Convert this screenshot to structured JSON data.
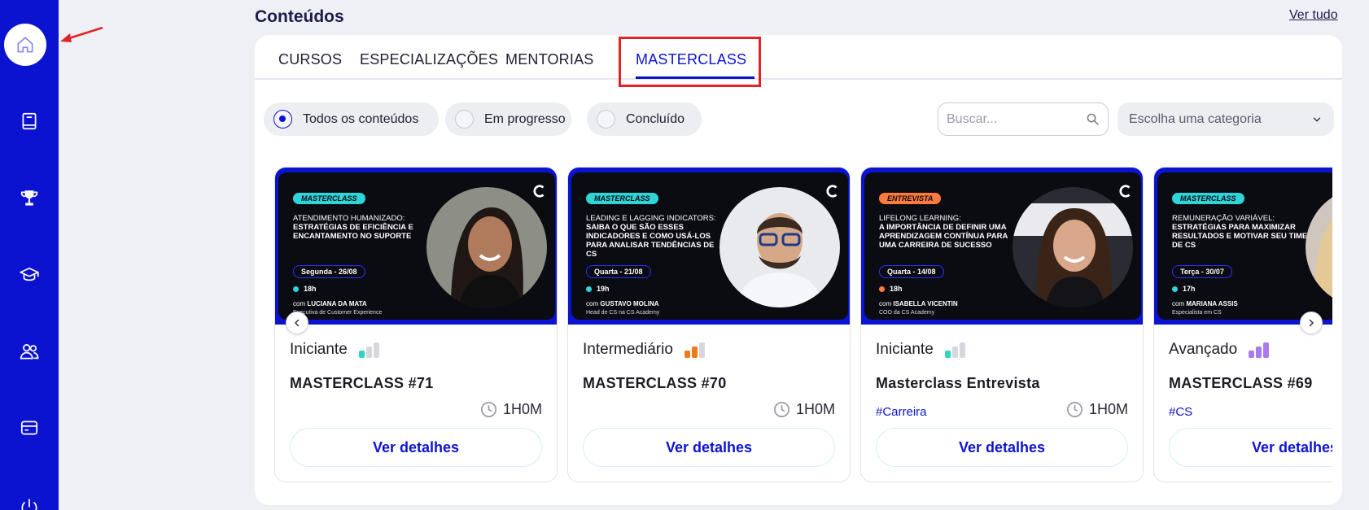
{
  "sidebar": {
    "items": [
      {
        "icon": "home-icon",
        "active": true
      },
      {
        "icon": "book-icon"
      },
      {
        "icon": "trophy-icon"
      },
      {
        "icon": "graduation-cap-icon"
      },
      {
        "icon": "users-icon"
      },
      {
        "icon": "card-icon"
      },
      {
        "icon": "power-icon"
      }
    ]
  },
  "header": {
    "title": "Conteúdos",
    "see_all": "Ver tudo"
  },
  "tabs": [
    {
      "label": "CURSOS"
    },
    {
      "label": "ESPECIALIZAÇÕES"
    },
    {
      "label": "MENTORIAS"
    },
    {
      "label": "MASTERCLASS",
      "active": true
    }
  ],
  "filters": {
    "options": [
      {
        "label": "Todos os conteúdos",
        "selected": true
      },
      {
        "label": "Em progresso"
      },
      {
        "label": "Concluído"
      }
    ],
    "search_placeholder": "Buscar...",
    "category_placeholder": "Escolha uma categoria"
  },
  "cards": [
    {
      "thumb": {
        "tag": "MASTERCLASS",
        "tag_color": "#2fd4d8",
        "headline_pre": "ATENDIMENTO HUMANIZADO:",
        "headline": "ESTRATÉGIAS DE EFICIÊNCIA E ENCANTAMENTO NO SUPORTE",
        "date": "Segunda - 26/08",
        "time": "18h",
        "dot_color": "#2fd4d8",
        "host_prefix": "com",
        "host": "LUCIANA DA MATA",
        "host_role": "Executiva de Customer Experience"
      },
      "level": "Iniciante",
      "level_color": "#2fd4c8",
      "level_filled": 1,
      "title": "MASTERCLASS #71",
      "tag": "",
      "duration": "1H0M",
      "button": "Ver detalhes"
    },
    {
      "thumb": {
        "tag": "MASTERCLASS",
        "tag_color": "#2fd4d8",
        "headline_pre": "LEADING E LAGGING INDICATORS:",
        "headline": "SAIBA O QUE SÃO ESSES INDICADORES E COMO USÁ-LOS PARA ANALISAR TENDÊNCIAS DE CS",
        "date": "Quarta - 21/08",
        "time": "19h",
        "dot_color": "#2fd4d8",
        "host_prefix": "com",
        "host": "GUSTAVO MOLINA",
        "host_role": "Head de CS na CS Academy"
      },
      "level": "Intermediário",
      "level_color": "#f07a1a",
      "level_filled": 2,
      "title": "MASTERCLASS #70",
      "tag": "",
      "duration": "1H0M",
      "button": "Ver detalhes"
    },
    {
      "thumb": {
        "tag": "ENTREVISTA",
        "tag_color": "#ff7a3d",
        "headline_pre": "LIFELONG LEARNING:",
        "headline": "A IMPORTÂNCIA DE DEFINIR UMA APRENDIZAGEM CONTÍNUA PARA UMA CARREIRA DE SUCESSO",
        "date": "Quarta - 14/08",
        "time": "18h",
        "dot_color": "#ff7a3d",
        "host_prefix": "com",
        "host": "ISABELLA VICENTIN",
        "host_role": "COO da CS Academy"
      },
      "level": "Iniciante",
      "level_color": "#2fd4c8",
      "level_filled": 1,
      "title": "Masterclass Entrevista",
      "tag": "#Carreira",
      "duration": "1H0M",
      "button": "Ver detalhes"
    },
    {
      "thumb": {
        "tag": "MASTERCLASS",
        "tag_color": "#2fd4d8",
        "headline_pre": "REMUNERAÇÃO VARIÁVEL:",
        "headline": "ESTRATÉGIAS PARA MAXIMIZAR RESULTADOS E MOTIVAR SEU TIME DE CS",
        "date": "Terça - 30/07",
        "time": "17h",
        "dot_color": "#2fd4d8",
        "host_prefix": "com",
        "host": "MARIANA ASSIS",
        "host_role": "Especialista em CS"
      },
      "level": "Avançado",
      "level_color": "#a77af0",
      "level_filled": 3,
      "title": "MASTERCLASS #69",
      "tag": "#CS",
      "duration": "",
      "button": "Ver detalhes"
    }
  ],
  "colors": {
    "brand": "#0b13d1",
    "highlight": "#e2232a",
    "arrow": "#e2232a"
  }
}
